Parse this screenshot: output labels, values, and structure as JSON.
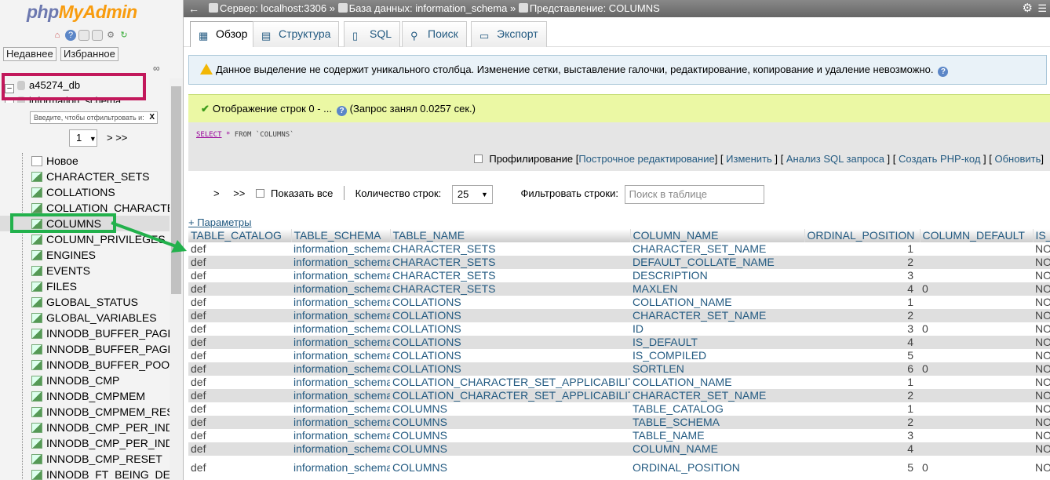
{
  "sidebar": {
    "logo": {
      "php": "php",
      "rest": "MyAdmin"
    },
    "quick_icons": [
      "home-icon",
      "logout-icon",
      "docs-icon",
      "sql-docs-icon",
      "settings-icon",
      "reload-icon"
    ],
    "recent_label": "Недавнее",
    "favorites_label": "Избранное",
    "databases": [
      {
        "name": "a45274_db"
      },
      {
        "name": "information_schema"
      }
    ],
    "filter_placeholder": "Введите, чтобы отфильтровать и:",
    "filter_clear": "X",
    "page_select": "1",
    "page_next": "> >>",
    "tree_items": [
      "Новое",
      "CHARACTER_SETS",
      "COLLATIONS",
      "COLLATION_CHARACTER_SET_APPLICABILITY",
      "COLUMNS",
      "COLUMN_PRIVILEGES",
      "ENGINES",
      "EVENTS",
      "FILES",
      "GLOBAL_STATUS",
      "GLOBAL_VARIABLES",
      "INNODB_BUFFER_PAGE",
      "INNODB_BUFFER_PAGE_LRU",
      "INNODB_BUFFER_POOL_STATS",
      "INNODB_CMP",
      "INNODB_CMPMEM",
      "INNODB_CMPMEM_RESET",
      "INNODB_CMP_PER_INDEX",
      "INNODB_CMP_PER_INDEX_RESET",
      "INNODB_CMP_RESET",
      "INNODB_FT_BEING_DELETED"
    ]
  },
  "topbar": {
    "server": "Сервер: localhost:3306",
    "sep1": "»",
    "database": "База данных: information_schema",
    "sep2": "»",
    "view": "Представление: COLUMNS"
  },
  "tabs": [
    {
      "label": "Обзор",
      "icon": "browse-icon",
      "active": true
    },
    {
      "label": "Структура",
      "icon": "structure-icon"
    },
    {
      "label": "SQL",
      "icon": "sql-icon"
    },
    {
      "label": "Поиск",
      "icon": "search-icon"
    },
    {
      "label": "Экспорт",
      "icon": "export-icon"
    }
  ],
  "notice": "Данное выделение не содержит уникального столбца. Изменение сетки, выставление галочки, редактирование, копирование и удаление невозможно.",
  "success": {
    "text": "Отображение строк 0 - ...",
    "query_time": "(Запрос занял 0.0257 сек.)"
  },
  "sql": {
    "select": "SELECT",
    "star": "*",
    "rest": "FROM `COLUMNS`"
  },
  "actions": {
    "profiling": "Профилирование",
    "inline_edit": "Построчное редактирование",
    "edit": "Изменить",
    "analyze": "Анализ SQL запроса",
    "php_code": "Создать PHP-код",
    "refresh": "Обновить"
  },
  "nav": {
    "next": ">",
    "last": ">>",
    "show_all": "Показать все",
    "rows_label": "Количество строк:",
    "rows_value": "25",
    "filter_label": "Фильтровать строки:",
    "filter_placeholder": "Поиск в таблице"
  },
  "params_link": "+ Параметры",
  "table": {
    "headers": [
      "TABLE_CATALOG",
      "TABLE_SCHEMA",
      "TABLE_NAME",
      "COLUMN_NAME",
      "ORDINAL_POSITION",
      "COLUMN_DEFAULT",
      "IS_"
    ],
    "rows": [
      [
        "def",
        "information_schema",
        "CHARACTER_SETS",
        "CHARACTER_SET_NAME",
        "1",
        "",
        "NO"
      ],
      [
        "def",
        "information_schema",
        "CHARACTER_SETS",
        "DEFAULT_COLLATE_NAME",
        "2",
        "",
        "NO"
      ],
      [
        "def",
        "information_schema",
        "CHARACTER_SETS",
        "DESCRIPTION",
        "3",
        "",
        "NO"
      ],
      [
        "def",
        "information_schema",
        "CHARACTER_SETS",
        "MAXLEN",
        "4",
        "0",
        "NO"
      ],
      [
        "def",
        "information_schema",
        "COLLATIONS",
        "COLLATION_NAME",
        "1",
        "",
        "NO"
      ],
      [
        "def",
        "information_schema",
        "COLLATIONS",
        "CHARACTER_SET_NAME",
        "2",
        "",
        "NO"
      ],
      [
        "def",
        "information_schema",
        "COLLATIONS",
        "ID",
        "3",
        "0",
        "NO"
      ],
      [
        "def",
        "information_schema",
        "COLLATIONS",
        "IS_DEFAULT",
        "4",
        "",
        "NO"
      ],
      [
        "def",
        "information_schema",
        "COLLATIONS",
        "IS_COMPILED",
        "5",
        "",
        "NO"
      ],
      [
        "def",
        "information_schema",
        "COLLATIONS",
        "SORTLEN",
        "6",
        "0",
        "NO"
      ],
      [
        "def",
        "information_schema",
        "COLLATION_CHARACTER_SET_APPLICABILITY",
        "COLLATION_NAME",
        "1",
        "",
        "NO"
      ],
      [
        "def",
        "information_schema",
        "COLLATION_CHARACTER_SET_APPLICABILITY",
        "CHARACTER_SET_NAME",
        "2",
        "",
        "NO"
      ],
      [
        "def",
        "information_schema",
        "COLUMNS",
        "TABLE_CATALOG",
        "1",
        "",
        "NO"
      ],
      [
        "def",
        "information_schema",
        "COLUMNS",
        "TABLE_SCHEMA",
        "2",
        "",
        "NO"
      ],
      [
        "def",
        "information_schema",
        "COLUMNS",
        "TABLE_NAME",
        "3",
        "",
        "NO"
      ],
      [
        "def",
        "information_schema",
        "COLUMNS",
        "COLUMN_NAME",
        "4",
        "",
        "NO"
      ],
      [
        "def",
        "information_schema",
        "COLUMNS",
        "ORDINAL_POSITION",
        "5",
        "0",
        "NO"
      ]
    ]
  },
  "colors": {
    "highlight_red": "#c2185b",
    "highlight_green": "#22b14c",
    "link": "#235a81"
  }
}
